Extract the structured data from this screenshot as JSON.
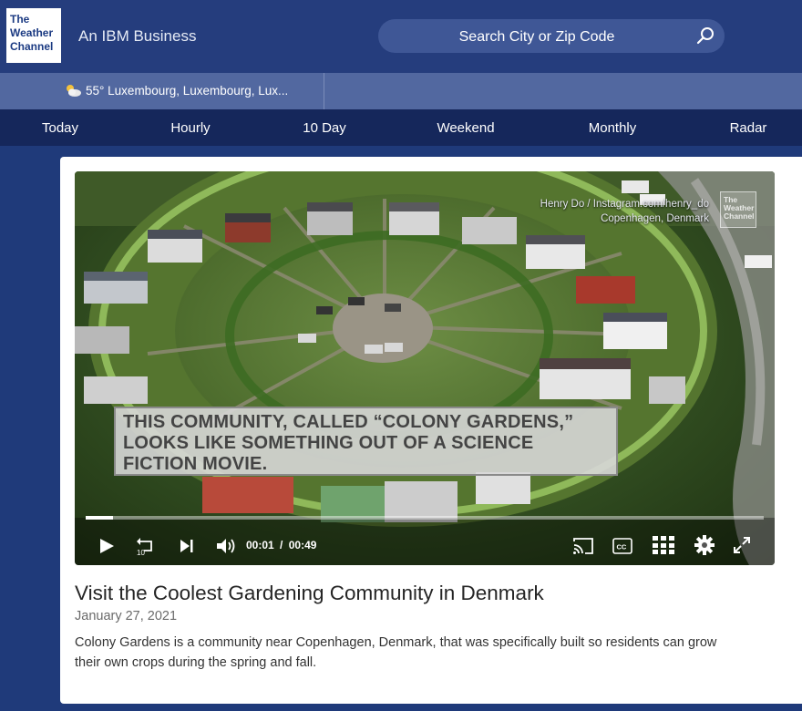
{
  "header": {
    "logo": {
      "line1": "The",
      "line2": "Weather",
      "line3": "Channel"
    },
    "tagline": "An IBM Business",
    "search_placeholder": "Search City or Zip Code"
  },
  "location": {
    "text": "55° Luxembourg, Luxembourg, Lux...",
    "icon": "partly-cloudy-icon"
  },
  "nav": [
    {
      "label": "Today"
    },
    {
      "label": "Hourly"
    },
    {
      "label": "10 Day"
    },
    {
      "label": "Weekend"
    },
    {
      "label": "Monthly"
    },
    {
      "label": "Radar"
    }
  ],
  "video": {
    "credit_line1": "Henry Do / Instagram.com/henry_do",
    "credit_line2": "Copenhagen, Denmark",
    "watermark": {
      "line1": "The",
      "line2": "Weather",
      "line3": "Channel"
    },
    "caption": "THIS COMMUNITY, CALLED “COLONY GARDENS,” LOOKS LIKE SOMETHING OUT OF A SCIENCE FICTION MOVIE.",
    "current_time": "00:01",
    "time_separator": "/",
    "duration": "00:49",
    "progress": 0.04,
    "rewind_seconds": "10"
  },
  "article": {
    "title": "Visit the Coolest Gardening Community in Denmark",
    "date": "January 27, 2021",
    "description": "Colony Gardens is a community near Copenhagen, Denmark, that was specifically built so residents can grow their own crops during the spring and fall."
  },
  "colors": {
    "header_bg": "#253d7d",
    "location_bar_bg": "#5268a0",
    "nav_bg": "#15275b",
    "page_bg": "#1f3a7a"
  }
}
